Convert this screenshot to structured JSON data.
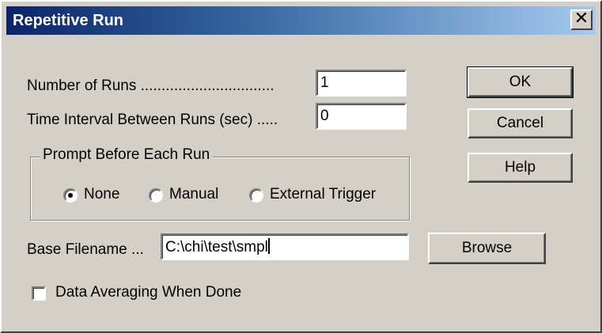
{
  "window": {
    "title": "Repetitive Run",
    "close_glyph": "✕"
  },
  "fields": {
    "runs": {
      "label": "Number of Runs ................................",
      "value": "1"
    },
    "interval": {
      "label": "Time Interval Between Runs (sec) .....",
      "value": "0"
    },
    "base_filename": {
      "label": "Base Filename ...",
      "value": "C:\\chi\\test\\smpl"
    }
  },
  "prompt_group": {
    "title": "Prompt Before Each Run",
    "options": [
      {
        "label": "None",
        "selected": true
      },
      {
        "label": "Manual",
        "selected": false
      },
      {
        "label": "External Trigger",
        "selected": false
      }
    ]
  },
  "checkbox": {
    "label": "Data Averaging When Done",
    "checked": false
  },
  "buttons": {
    "ok": "OK",
    "cancel": "Cancel",
    "help": "Help",
    "browse": "Browse"
  }
}
